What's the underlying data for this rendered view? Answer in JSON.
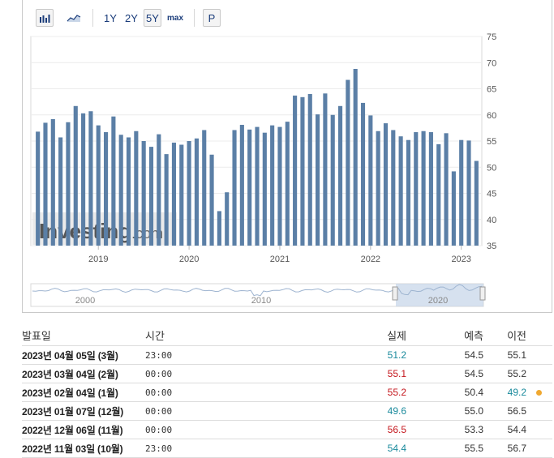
{
  "toolbar": {
    "ranges": [
      "1Y",
      "2Y",
      "5Y",
      "max"
    ],
    "active_range": "5Y",
    "p_label": "P",
    "icons": [
      "bar-chart-icon",
      "area-chart-icon"
    ]
  },
  "chart_data": {
    "type": "bar",
    "x_start": "2018-05",
    "x_end": "2023-03",
    "values": [
      56.8,
      58.5,
      59.2,
      55.7,
      58.6,
      61.7,
      60.3,
      60.7,
      58.0,
      56.7,
      59.7,
      56.2,
      55.7,
      56.9,
      55.0,
      53.9,
      56.3,
      52.5,
      54.7,
      54.3,
      55.0,
      55.5,
      57.1,
      52.4,
      41.6,
      45.2,
      57.1,
      58.1,
      57.2,
      57.7,
      56.6,
      58.0,
      57.7,
      58.7,
      63.7,
      63.4,
      64.0,
      60.1,
      64.1,
      60.0,
      61.7,
      66.7,
      68.8,
      62.3,
      59.9,
      56.9,
      58.4,
      57.1,
      55.9,
      55.2,
      56.7,
      56.9,
      56.7,
      54.4,
      56.5,
      49.2,
      55.2,
      55.1,
      51.2
    ],
    "ylim": [
      35,
      75
    ],
    "yticks": [
      35,
      40,
      45,
      50,
      55,
      60,
      65,
      70,
      75
    ],
    "xticks": [
      "2019",
      "2020",
      "2021",
      "2022",
      "2023"
    ],
    "bar_color": "#5b7fa6",
    "grid": true,
    "watermark": "Investing.com",
    "navigator": {
      "labels": [
        "2000",
        "2010",
        "2020"
      ]
    }
  },
  "table": {
    "headers": {
      "date": "발표일",
      "time": "시간",
      "actual": "실제",
      "forecast": "예측",
      "previous": "이전"
    },
    "rows": [
      {
        "date": "2023년 04월 05일 (3월)",
        "time": "23:00",
        "actual": "51.2",
        "actual_color": "green",
        "forecast": "54.5",
        "previous": "55.1",
        "previous_color": "",
        "dot": false
      },
      {
        "date": "2023년 03월 04일 (2월)",
        "time": "00:00",
        "actual": "55.1",
        "actual_color": "red",
        "forecast": "54.5",
        "previous": "55.2",
        "previous_color": "",
        "dot": false
      },
      {
        "date": "2023년 02월 04일 (1월)",
        "time": "00:00",
        "actual": "55.2",
        "actual_color": "red",
        "forecast": "50.4",
        "previous": "49.2",
        "previous_color": "green",
        "dot": true
      },
      {
        "date": "2023년 01월 07일 (12월)",
        "time": "00:00",
        "actual": "49.6",
        "actual_color": "green",
        "forecast": "55.0",
        "previous": "56.5",
        "previous_color": "",
        "dot": false
      },
      {
        "date": "2022년 12월 06일 (11월)",
        "time": "00:00",
        "actual": "56.5",
        "actual_color": "red",
        "forecast": "53.3",
        "previous": "54.4",
        "previous_color": "",
        "dot": false
      },
      {
        "date": "2022년 11월 03일 (10월)",
        "time": "23:00",
        "actual": "54.4",
        "actual_color": "green",
        "forecast": "55.5",
        "previous": "56.7",
        "previous_color": "",
        "dot": false
      }
    ]
  }
}
